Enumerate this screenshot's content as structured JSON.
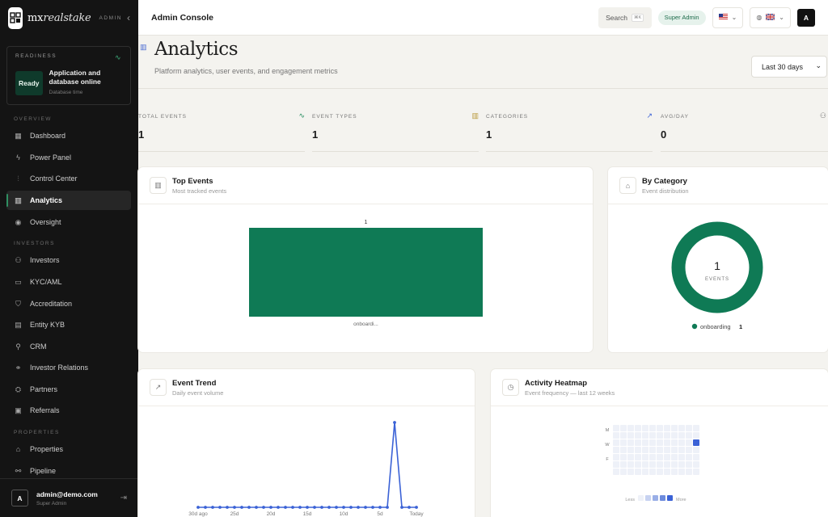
{
  "brand": {
    "name_prefix": "mx",
    "name_italic": "realstake",
    "tag": "ADMIN"
  },
  "readiness": {
    "label": "READINESS",
    "status": "Ready",
    "title_line1": "Application and",
    "title_line2": "database online",
    "sub": "Database time"
  },
  "sidebar": {
    "sections": [
      "OVERVIEW",
      "INVESTORS",
      "PROPERTIES"
    ],
    "items": [
      {
        "label": "Dashboard",
        "icon": "grid-icon"
      },
      {
        "label": "Power Panel",
        "icon": "bolt-icon"
      },
      {
        "label": "Control Center",
        "icon": "sliders-icon"
      },
      {
        "label": "Analytics",
        "icon": "bar-chart-icon"
      },
      {
        "label": "Oversight",
        "icon": "eye-icon"
      },
      {
        "label": "Investors",
        "icon": "users-icon"
      },
      {
        "label": "KYC/AML",
        "icon": "id-card-icon"
      },
      {
        "label": "Accreditation",
        "icon": "shield-icon"
      },
      {
        "label": "Entity KYB",
        "icon": "building-icon"
      },
      {
        "label": "CRM",
        "icon": "user-plus-icon"
      },
      {
        "label": "Investor Relations",
        "icon": "handshake-icon"
      },
      {
        "label": "Partners",
        "icon": "partners-icon"
      },
      {
        "label": "Referrals",
        "icon": "gift-icon"
      },
      {
        "label": "Properties",
        "icon": "home-icon"
      },
      {
        "label": "Pipeline",
        "icon": "pipeline-icon"
      }
    ],
    "user": {
      "initial": "A",
      "email": "admin@demo.com",
      "role": "Super Admin"
    }
  },
  "topbar": {
    "title": "Admin Console",
    "search_label": "Search",
    "search_kbd": "⌘K",
    "role_badge": "Super Admin",
    "avatar": "A"
  },
  "page": {
    "title": "Analytics",
    "subtitle": "Platform analytics, user events, and engagement metrics",
    "range": "Last 30 days"
  },
  "stats": [
    {
      "label": "TOTAL EVENTS",
      "value": "1"
    },
    {
      "label": "EVENT TYPES",
      "value": "1"
    },
    {
      "label": "CATEGORIES",
      "value": "1"
    },
    {
      "label": "AVG/DAY",
      "value": "0"
    }
  ],
  "cards": {
    "top_events": {
      "title": "Top Events",
      "sub": "Most tracked events"
    },
    "by_category": {
      "title": "By Category",
      "sub": "Event distribution",
      "center_value": "1",
      "center_label": "EVENTS",
      "legend_label": "onboarding",
      "legend_value": "1"
    },
    "event_trend": {
      "title": "Event Trend",
      "sub": "Daily event volume"
    },
    "heatmap": {
      "title": "Activity Heatmap",
      "sub": "Event frequency — last 12 weeks",
      "day_labels": [
        "M",
        "W",
        "F"
      ],
      "legend_less": "Less",
      "legend_more": "More"
    }
  },
  "colors": {
    "accent": "#0f7a55",
    "trend": "#3b62d6",
    "sidebar": "#141414"
  },
  "chart_data": [
    {
      "type": "bar",
      "title": "Top Events",
      "categories": [
        "onboardi..."
      ],
      "values": [
        1
      ],
      "data_labels": [
        "1"
      ]
    },
    {
      "type": "pie",
      "title": "By Category",
      "categories": [
        "onboarding"
      ],
      "values": [
        1
      ]
    },
    {
      "type": "line",
      "title": "Event Trend",
      "x_ticks": [
        "30d ago",
        "25d",
        "20d",
        "15d",
        "10d",
        "5d",
        "Today"
      ],
      "values": [
        0,
        0,
        0,
        0,
        0,
        0,
        0,
        0,
        0,
        0,
        0,
        0,
        0,
        0,
        0,
        0,
        0,
        0,
        0,
        0,
        0,
        0,
        0,
        0,
        0,
        0,
        0,
        1,
        0,
        0,
        0
      ]
    },
    {
      "type": "heatmap",
      "title": "Activity Heatmap",
      "rows": 7,
      "cols": 12,
      "cells": [
        {
          "week": 12,
          "day": 3,
          "value": 1
        }
      ]
    }
  ]
}
